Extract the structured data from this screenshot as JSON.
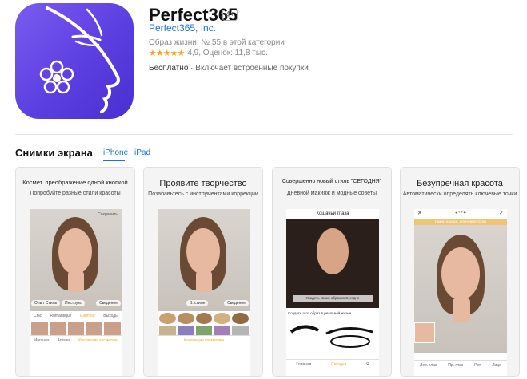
{
  "app": {
    "title": "Perfect365",
    "age": "4+",
    "developer": "Perfect365, Inc.",
    "rank": "Образ жизни: № 55 в этой категории",
    "stars": "★★★★★",
    "rating": "4,9, Оценок: 11,8 тыс.",
    "price": "Бесплатно",
    "purchases": " · Включает встроенные покупки"
  },
  "screenshots": {
    "title": "Снимки экрана",
    "tabs": [
      "iPhone",
      "iPad"
    ],
    "items": [
      {
        "caption1": "Космет. преображение одной кнопкой",
        "caption2": "Попробуйте разные стили красоты",
        "top_label": "Сохранить",
        "pill_left": "Опыт Стиль",
        "pill_mid": "Инструм.",
        "pill_right": "Сведение",
        "strip": [
          "Chic",
          "Romantique",
          "Glamour",
          "Выходы"
        ],
        "bar": [
          "Marques",
          "Artistes",
          "Коллекция косметики"
        ]
      },
      {
        "caption1": "Проявите творчество",
        "caption2": "Позабавьтесь с инструментами коррекции",
        "pill_mid": "В. стиле",
        "pill_right": "Сведение",
        "bar": [
          "Коллекция косметики"
        ]
      },
      {
        "caption1": "Совершенно новый стиль \"СЕГОДНЯ\"",
        "caption2": "Дневной макияж и модные советы",
        "top_label": "Кошачьи глаза",
        "photo_label": "Увидеть своих образов Сегодня",
        "row_label": "Создать этот образ в реальной жизни",
        "bar": [
          "Главная",
          "Сегодня",
          "Я"
        ]
      },
      {
        "caption1": "Безупречная красота",
        "caption2": "Автоматически определять ключевые точки",
        "hint": "Нажм. и держ. ключевые точки",
        "bar": [
          "Лев. глаз",
          "Пр. глаз",
          "Рот",
          "Лицо"
        ]
      }
    ]
  }
}
